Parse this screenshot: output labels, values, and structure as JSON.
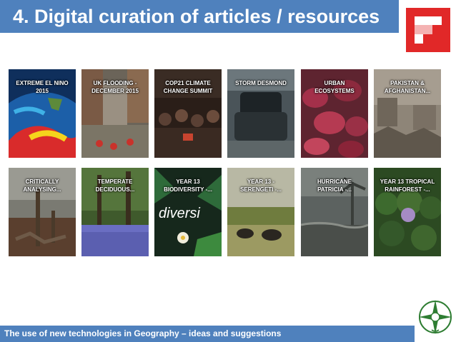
{
  "slide": {
    "title": "4. Digital curation of articles / resources",
    "footer": "The use of new technologies in Geography – ideas and suggestions"
  },
  "logo": {
    "icon": "flipboard-icon",
    "color": "#e12828"
  },
  "school_logo": {
    "icon": "st-ivo-geography-seal-icon",
    "color": "#2e7d32"
  },
  "tiles": [
    {
      "label": "EXTREME EL NINO 2015"
    },
    {
      "label": "UK FLOODING - DECEMBER 2015"
    },
    {
      "label": "COP21 CLIMATE CHANGE SUMMIT"
    },
    {
      "label": "STORM DESMOND"
    },
    {
      "label": "URBAN ECOSYSTEMS"
    },
    {
      "label": "PAKISTAN & AFGHANISTAN..."
    },
    {
      "label": "CRITICALLY ANALYSING..."
    },
    {
      "label": "TEMPERATE DECIDUOUS..."
    },
    {
      "label": "YEAR 13 BIODIVERSITY -..."
    },
    {
      "label": "YEAR 13 - SERENGETI -..."
    },
    {
      "label": "HURRICANE PATRICIA -..."
    },
    {
      "label": "YEAR 13 TROPICAL RAINFOREST -..."
    }
  ]
}
